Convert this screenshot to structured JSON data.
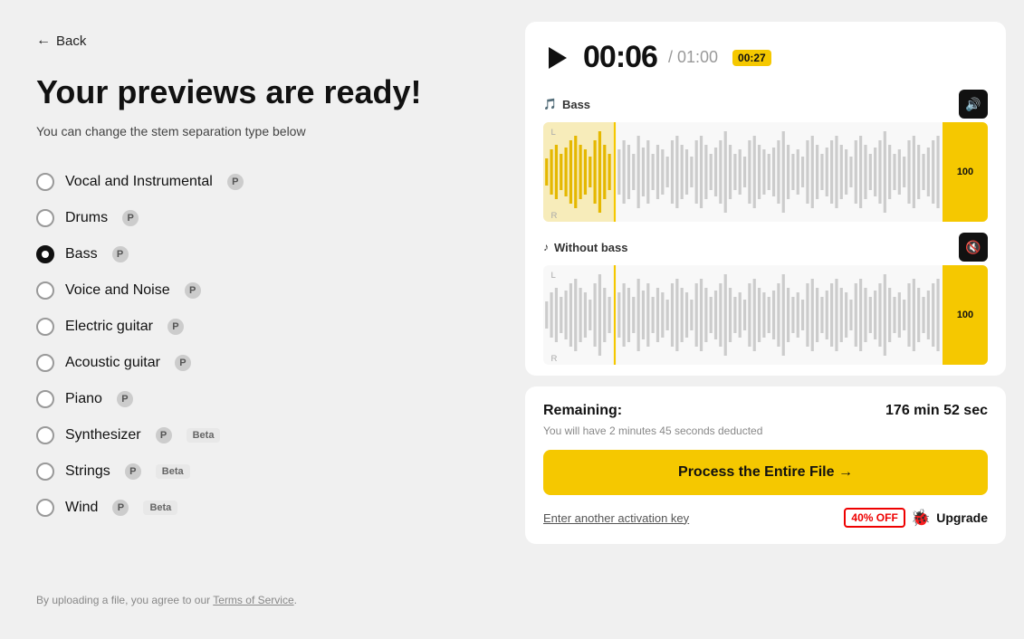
{
  "back": {
    "label": "Back"
  },
  "left": {
    "title": "Your previews are ready!",
    "subtitle": "You can change the stem separation type below",
    "stems": [
      {
        "id": "vocal-instrumental",
        "label": "Vocal and Instrumental",
        "selected": false,
        "pro": true,
        "beta": false
      },
      {
        "id": "drums",
        "label": "Drums",
        "selected": false,
        "pro": true,
        "beta": false
      },
      {
        "id": "bass",
        "label": "Bass",
        "selected": true,
        "pro": true,
        "beta": false
      },
      {
        "id": "voice-noise",
        "label": "Voice and Noise",
        "selected": false,
        "pro": true,
        "beta": false
      },
      {
        "id": "electric-guitar",
        "label": "Electric guitar",
        "selected": false,
        "pro": true,
        "beta": false
      },
      {
        "id": "acoustic-guitar",
        "label": "Acoustic guitar",
        "selected": false,
        "pro": true,
        "beta": false
      },
      {
        "id": "piano",
        "label": "Piano",
        "selected": false,
        "pro": true,
        "beta": false
      },
      {
        "id": "synthesizer",
        "label": "Synthesizer",
        "selected": false,
        "pro": true,
        "beta": true
      },
      {
        "id": "strings",
        "label": "Strings",
        "selected": false,
        "pro": true,
        "beta": true
      },
      {
        "id": "wind",
        "label": "Wind",
        "selected": false,
        "pro": true,
        "beta": true
      }
    ],
    "footer": "By uploading a file, you agree to our",
    "footer_link": "Terms of Service",
    "footer_period": "."
  },
  "player": {
    "time_current": "00:06",
    "time_total": "/ 01:00",
    "time_marker": "00:27",
    "track1": {
      "name": "Bass",
      "icon": "🎵",
      "volume": "100",
      "muted": false
    },
    "track2": {
      "name": "Without bass",
      "icon": "♪",
      "volume": "100",
      "muted": true
    }
  },
  "remaining": {
    "label": "Remaining:",
    "time": "176 min 52 sec",
    "sub": "You will have 2 minutes 45 seconds deducted",
    "process_btn": "Process the Entire File →",
    "activation_label": "Enter another activation key",
    "discount": "40% OFF",
    "upgrade": "Upgrade"
  }
}
